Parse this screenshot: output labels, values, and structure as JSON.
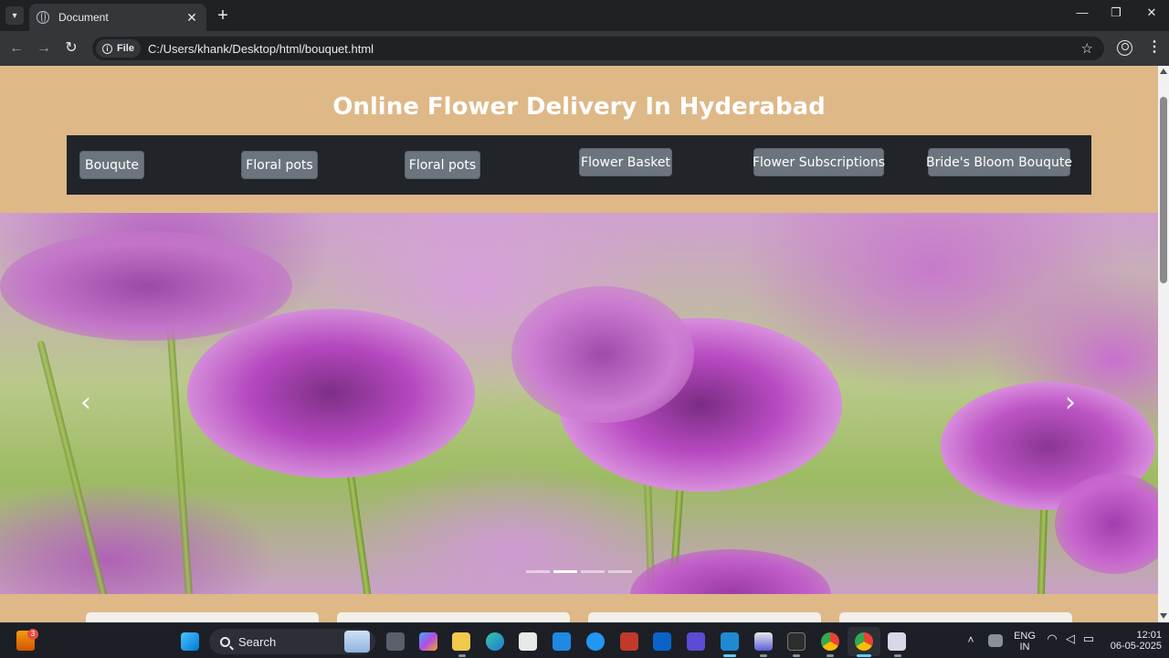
{
  "browser": {
    "tab_title": "Document",
    "tab_close": "✕",
    "new_tab": "+",
    "security_chip": "File",
    "url": "C:/Users/khank/Desktop/html/bouquet.html",
    "window_minimize": "—",
    "window_maximize": "❐",
    "window_close": "✕"
  },
  "page": {
    "heading": "Online Flower Delivery In Hyderabad",
    "nav_buttons": [
      "Bouqute",
      "Floral pots",
      "Floral pots",
      "Flower Basket",
      "Flower Subscriptions",
      "Bride's Bloom Bouqute"
    ],
    "carousel": {
      "prev": "‹",
      "next": "›",
      "slide_count": 4,
      "active_slide": 2
    }
  },
  "taskbar": {
    "search_label": "Search",
    "notification_badge": "3",
    "language_line1": "ENG",
    "language_line2": "IN",
    "time": "12:01",
    "date": "06-05-2025"
  },
  "colors": {
    "page_background": "#deb887",
    "navbar_background": "#212529",
    "nav_button": "#6c757d"
  }
}
